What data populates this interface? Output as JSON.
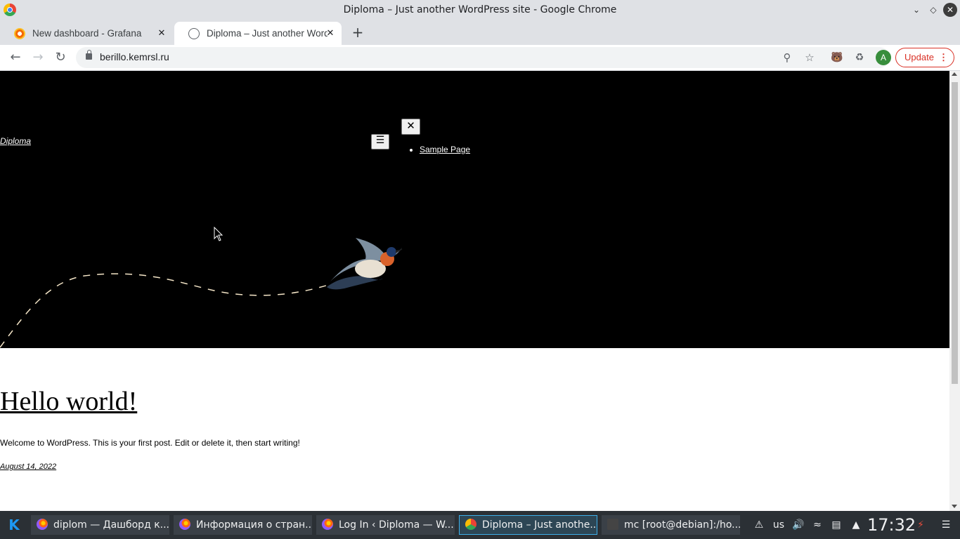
{
  "window": {
    "title": "Diploma – Just another WordPress site - Google Chrome"
  },
  "tabs": [
    {
      "label": "New dashboard - Grafana",
      "icon": "grafana-icon",
      "active": false
    },
    {
      "label": "Diploma – Just another WordPress site",
      "icon": "globe-icon",
      "active": true
    }
  ],
  "toolbar": {
    "url": "berillo.kemrsl.ru",
    "update_label": "Update",
    "avatar_letter": "A"
  },
  "site": {
    "title": "Diploma",
    "menu": [
      {
        "label": "Sample Page"
      }
    ]
  },
  "post": {
    "title": "Hello world!",
    "excerpt": "Welcome to WordPress. This is your first post. Edit or delete it, then start writing!",
    "date": "August 14, 2022"
  },
  "taskbar": {
    "tasks": [
      {
        "label": "diplom — Дашборд к...",
        "icon": "firefox-icon"
      },
      {
        "label": "Информация о стран...",
        "icon": "firefox-icon"
      },
      {
        "label": "Log In ‹ Diploma — W...",
        "icon": "firefox-icon"
      },
      {
        "label": "Diploma – Just anothe...",
        "icon": "chrome-icon",
        "active": true
      },
      {
        "label": "mc [root@debian]:/ho...",
        "icon": "terminal-icon"
      }
    ],
    "keyboard_layout": "us",
    "clock": "17:32"
  },
  "colors": {
    "hero_bg": "#000000",
    "taskbar_bg": "#2b3035",
    "accent": "#3daee9",
    "update_red": "#d93025"
  }
}
